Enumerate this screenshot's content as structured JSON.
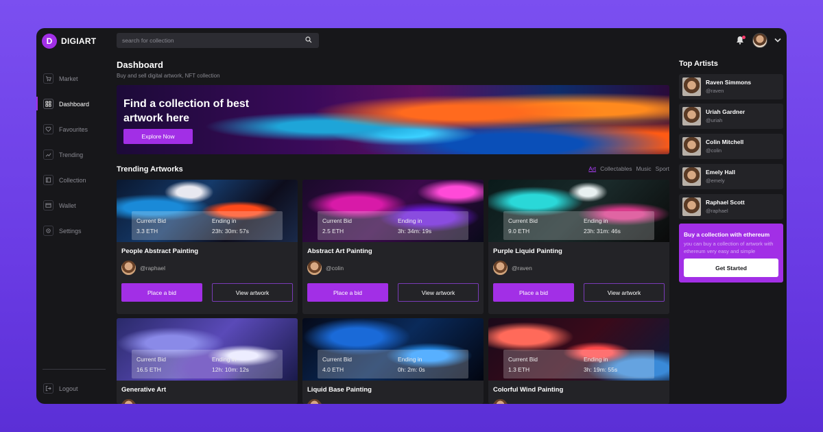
{
  "brand": {
    "logo_letter": "D",
    "name": "DIGIART"
  },
  "search": {
    "placeholder": "search for collection"
  },
  "sidebar": {
    "items": [
      {
        "label": "Market",
        "icon": "cart-icon"
      },
      {
        "label": "Dashboard",
        "icon": "grid-icon",
        "active": true
      },
      {
        "label": "Favourites",
        "icon": "heart-icon"
      },
      {
        "label": "Trending",
        "icon": "trend-icon"
      },
      {
        "label": "Collection",
        "icon": "collection-icon"
      },
      {
        "label": "Wallet",
        "icon": "wallet-icon"
      },
      {
        "label": "Settings",
        "icon": "gear-icon"
      }
    ],
    "logout": "Logout"
  },
  "header": {
    "title": "Dashboard",
    "subtitle": "Buy and sell digital artwork, NFT collection"
  },
  "banner": {
    "title": "Find a collection of best artwork here",
    "button": "Explore Now"
  },
  "trending": {
    "title": "Trending Artworks",
    "filters": [
      "Art",
      "Collectables",
      "Music",
      "Sport"
    ],
    "bid_label": "Current Bid",
    "ending_label": "Ending in",
    "place_bid": "Place a bid",
    "view_artwork": "View artwork",
    "cards": [
      {
        "title": "People Abstract Painting",
        "bid": "3.3 ETH",
        "ending": "23h: 30m: 57s",
        "user": "@raphael"
      },
      {
        "title": "Abstract Art Painting",
        "bid": "2.5 ETH",
        "ending": "3h: 34m: 19s",
        "user": "@colin"
      },
      {
        "title": "Purple Liquid Painting",
        "bid": "9.0 ETH",
        "ending": "23h: 31m: 46s",
        "user": "@raven"
      },
      {
        "title": "Generative Art",
        "bid": "16.5 ETH",
        "ending": "12h: 10m: 12s"
      },
      {
        "title": "Liquid Base Painting",
        "bid": "4.0 ETH",
        "ending": "0h: 2m: 0s"
      },
      {
        "title": "Colorful Wind Painting",
        "bid": "1.3 ETH",
        "ending": "3h: 19m: 55s"
      }
    ]
  },
  "top_artists": {
    "title": "Top Artists",
    "items": [
      {
        "name": "Raven Simmons",
        "handle": "@raven"
      },
      {
        "name": "Uriah Gardner",
        "handle": "@uriah"
      },
      {
        "name": "Colin Mitchell",
        "handle": "@colin"
      },
      {
        "name": "Emely Hall",
        "handle": "@emely"
      },
      {
        "name": "Raphael Scott",
        "handle": "@raphael"
      }
    ]
  },
  "promo": {
    "title": "Buy a collection with ethereum",
    "text": "you can buy a collection of artwork with ethereum very easy and simple",
    "button": "Get Started"
  },
  "colors": {
    "accent": "#a22fe6",
    "background": "#17171a",
    "card": "#232327",
    "page": "#6a3be4"
  }
}
